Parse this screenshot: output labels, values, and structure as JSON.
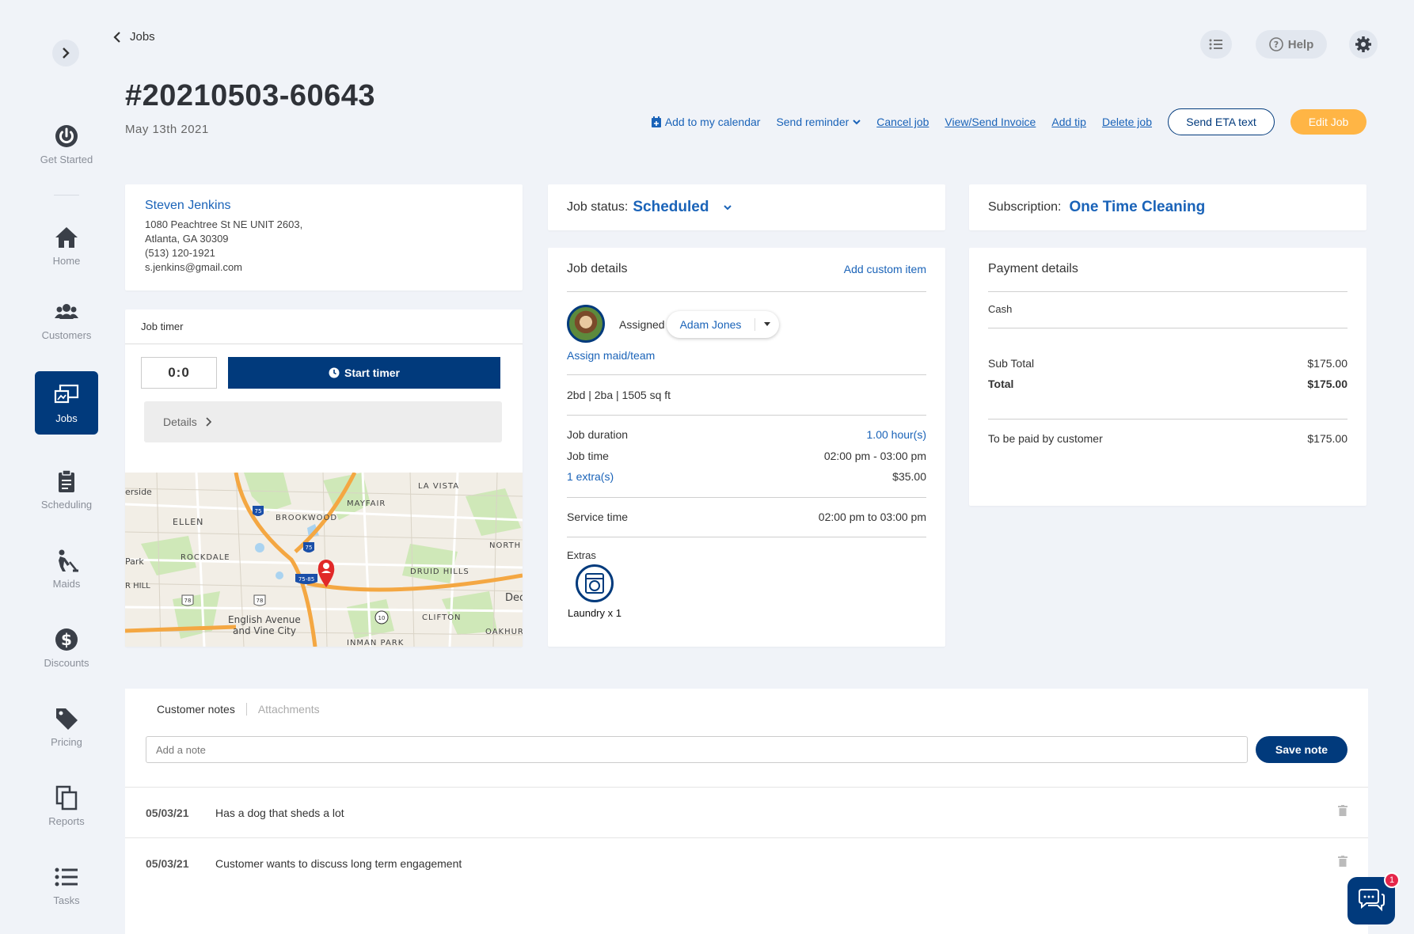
{
  "topbar": {
    "back_label": "Jobs",
    "help_label": "Help"
  },
  "sidebar": {
    "items": [
      {
        "label": "Get Started",
        "icon": "power-icon"
      },
      {
        "label": "Home",
        "icon": "home-icon"
      },
      {
        "label": "Customers",
        "icon": "users-icon"
      },
      {
        "label": "Jobs",
        "icon": "jobs-icon",
        "active": true
      },
      {
        "label": "Scheduling",
        "icon": "clipboard-icon"
      },
      {
        "label": "Maids",
        "icon": "maid-icon"
      },
      {
        "label": "Discounts",
        "icon": "dollar-icon"
      },
      {
        "label": "Pricing",
        "icon": "tag-icon"
      },
      {
        "label": "Reports",
        "icon": "copy-icon"
      },
      {
        "label": "Tasks",
        "icon": "list-icon"
      }
    ]
  },
  "job": {
    "number": "#20210503-60643",
    "date": "May 13th 2021"
  },
  "actions": {
    "add_calendar": "Add to my calendar",
    "send_reminder": "Send reminder",
    "cancel_job": "Cancel job",
    "view_invoice": "View/Send Invoice",
    "add_tip": "Add tip",
    "delete_job": "Delete job",
    "send_eta": "Send ETA text",
    "edit_job": "Edit Job"
  },
  "customer": {
    "name": "Steven Jenkins",
    "address1": "1080 Peachtree St NE UNIT 2603,",
    "address2": "Atlanta, GA 30309",
    "phone": "(513) 120-1921",
    "email": "s.jenkins@gmail.com"
  },
  "timer": {
    "header": "Job timer",
    "value": "0:0",
    "start_label": "Start timer",
    "details_label": "Details"
  },
  "map": {
    "labels": [
      "erside",
      "ELLEN",
      "BROOKWOOD",
      "MAYFAIR",
      "LA VISTA",
      "NORTH DECATUR",
      "Park",
      "ROCKDALE",
      "DRUID HILLS",
      "R HILL",
      "English Avenue",
      "and Vine City",
      "CLIFTON",
      "INMAN PARK",
      "OAKHUR",
      "Dec"
    ],
    "shields": [
      "75",
      "75",
      "75-85",
      "78",
      "78",
      "10"
    ]
  },
  "status": {
    "label": "Job status:",
    "value": "Scheduled"
  },
  "subscription": {
    "label": "Subscription:",
    "value": "One Time Cleaning"
  },
  "job_details": {
    "title": "Job details",
    "add_custom": "Add custom item",
    "assigned_label": "Assigned to:",
    "assignee": "Adam Jones",
    "assign_link": "Assign maid/team",
    "property": "2bd | 2ba | 1505 sq ft",
    "duration_label": "Job duration",
    "duration_value": "1.00 hour(s)",
    "time_label": "Job time",
    "time_value": "02:00 pm - 03:00 pm",
    "extras_link": "1 extra(s)",
    "extras_price": "$35.00",
    "service_label": "Service time",
    "service_value": "02:00 pm to 03:00 pm",
    "extras_heading": "Extras",
    "extra_item": "Laundry x 1"
  },
  "payment": {
    "title": "Payment details",
    "method": "Cash",
    "subtotal_label": "Sub Total",
    "subtotal": "$175.00",
    "total_label": "Total",
    "total": "$175.00",
    "paid_label": "To be paid by customer",
    "paid": "$175.00"
  },
  "notes": {
    "tab_notes": "Customer notes",
    "tab_attachments": "Attachments",
    "placeholder": "Add a note",
    "save_label": "Save note",
    "items": [
      {
        "date": "05/03/21",
        "text": "Has a dog that sheds a lot"
      },
      {
        "date": "05/03/21",
        "text": "Customer wants to discuss long term engagement"
      }
    ]
  },
  "chat": {
    "badge": "1"
  },
  "colors": {
    "primary": "#013a7c",
    "link": "#1a63b8",
    "accent": "#ffb545",
    "background": "#f0f3f8"
  }
}
